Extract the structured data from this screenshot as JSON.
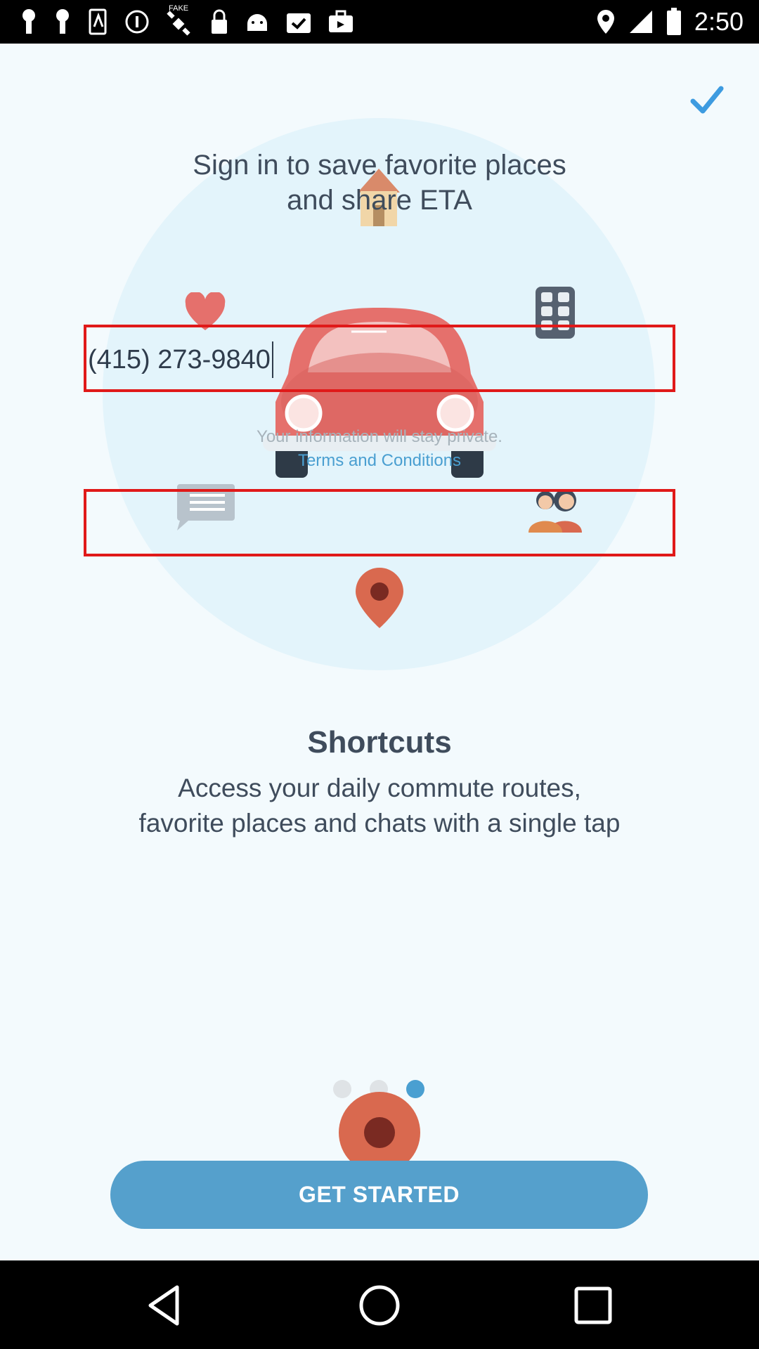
{
  "status_bar": {
    "time": "2:50",
    "icons": [
      "key-icon",
      "key-icon",
      "screen-icon",
      "info-icon",
      "satellite-icon",
      "lock-icon",
      "android-icon",
      "clipboard-check-icon",
      "briefcase-icon",
      "location-icon",
      "signal-icon",
      "battery-icon"
    ],
    "fake_label": "FAKE"
  },
  "header": {
    "title_line1": "Sign in to save favorite places",
    "title_line2": "and share ETA"
  },
  "phone_input": {
    "value": "(415) 273-9840"
  },
  "privacy": {
    "note": "Your information will stay private.",
    "terms_link": "Terms and Conditions"
  },
  "feature": {
    "heading": "Shortcuts",
    "line1": "Access your daily commute routes,",
    "line2": "favorite places and chats with a single tap"
  },
  "pager": {
    "count": 3,
    "active_index": 2
  },
  "cta": {
    "label": "GET STARTED"
  },
  "colors": {
    "accent": "#55a0cc",
    "link": "#4a9fd1",
    "car": "#e5706c",
    "pin": "#d9694f",
    "highlight_box": "#e01919"
  },
  "navigation": {
    "back_icon": "back-triangle-icon",
    "home_icon": "home-circle-icon",
    "recents_icon": "recents-square-icon"
  }
}
